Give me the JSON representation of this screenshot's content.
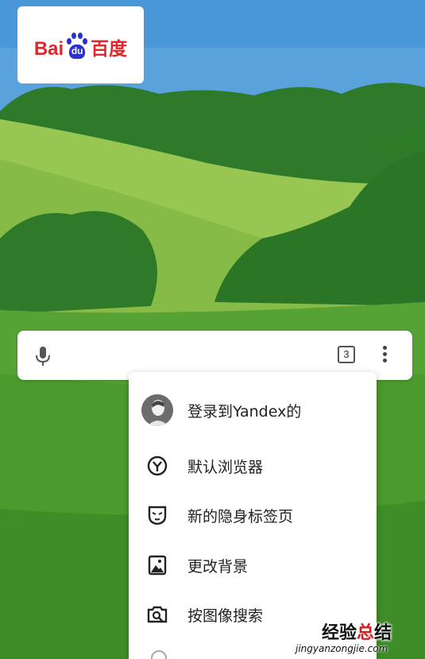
{
  "logo": {
    "latin": "Bai",
    "paw": "du",
    "chinese": "百度"
  },
  "search_bar": {
    "tab_count": "3"
  },
  "menu": {
    "items": [
      {
        "label": "登录到Yandex的",
        "icon": "avatar-icon"
      },
      {
        "label": "默认浏览器",
        "icon": "yandex-browser-icon"
      },
      {
        "label": "新的隐身标签页",
        "icon": "incognito-mask-icon"
      },
      {
        "label": "更改背景",
        "icon": "image-icon"
      },
      {
        "label": "按图像搜索",
        "icon": "camera-search-icon"
      }
    ]
  },
  "watermark": {
    "chinese": "经验总结",
    "highlight": "总",
    "url": "jingyanzongjie.com"
  }
}
